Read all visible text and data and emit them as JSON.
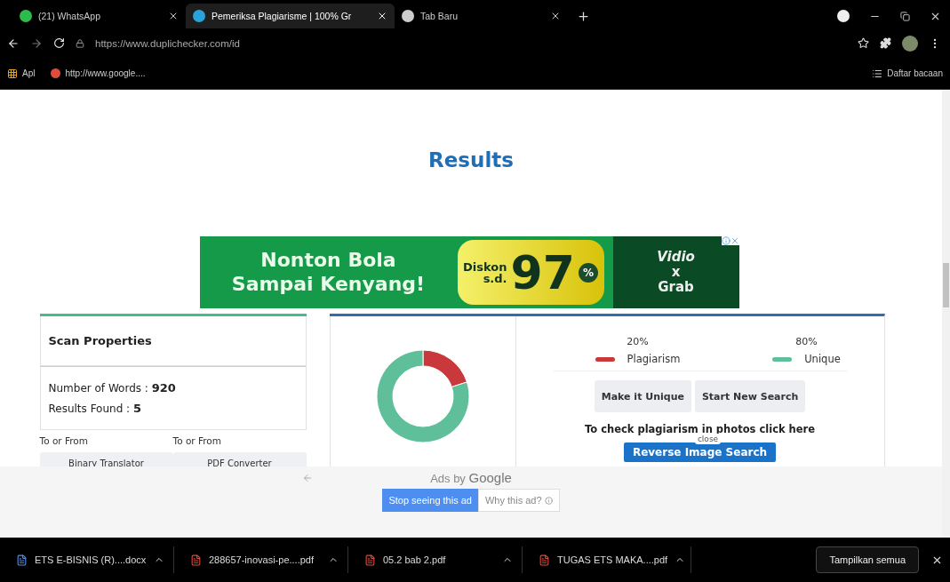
{
  "browser": {
    "tabs": [
      {
        "title": "(21) WhatsApp",
        "kind": "whatsapp",
        "selected": false
      },
      {
        "title": "Pemeriksa Plagiarisme | 100% Gr",
        "kind": "site",
        "selected": true
      },
      {
        "title": "Tab Baru",
        "kind": "chrome",
        "selected": false
      }
    ],
    "url": "https://www.duplichecker.com/id",
    "bookmarks": [
      {
        "label": "Apl",
        "kind": "apps"
      },
      {
        "label": "http://www.google....",
        "kind": "chrome"
      }
    ],
    "reading_list": "Daftar bacaan"
  },
  "page": {
    "heading": "Results",
    "ad_banner": {
      "line_1": "Nonton Bola",
      "line_2": "Sampai Kenyang!",
      "discount_1": "Diskon",
      "discount_2": "s.d.",
      "number": "97",
      "percent": "%",
      "brand_1": "Vidio",
      "brand_2": "x",
      "brand_3": "Grab"
    },
    "scan_properties": {
      "title": "Scan Properties",
      "rows": [
        {
          "label": "Number of Words : ",
          "value": "920"
        },
        {
          "label": "Results Found : ",
          "value": "5"
        }
      ],
      "links": [
        {
          "caption": "To or From",
          "button": "Binary Translator"
        },
        {
          "caption": "To or From",
          "button": "PDF Converter"
        }
      ]
    },
    "results": {
      "chart_data": {
        "type": "donut",
        "categories": [
          "Plagiarism",
          "Unique"
        ],
        "values": [
          20,
          80
        ]
      },
      "legend": [
        {
          "percent": "20%",
          "color": "#c9383a"
        },
        {
          "percent": "80%",
          "color": "#5fbf9a"
        }
      ],
      "buttons": [
        "Make it Unique",
        "Start New Search"
      ],
      "photo_hint": "To check plagiarism in photos click here",
      "reverse_button": "Reverse Image Search",
      "tooltip": "close"
    },
    "ad_overlay": {
      "label_prefix": "Ads by ",
      "label_brand": "Google",
      "stop_button": "Stop seeing this ad",
      "why_button": "Why this ad?"
    }
  },
  "downloads": {
    "items": [
      {
        "name": "ETS E-BISNIS (R)....docx",
        "kind": "docx"
      },
      {
        "name": "288657-inovasi-pe....pdf",
        "kind": "pdf"
      },
      {
        "name": "05.2 bab 2.pdf",
        "kind": "pdf"
      },
      {
        "name": "TUGAS ETS MAKA....pdf",
        "kind": "pdf"
      }
    ],
    "show_all": "Tampilkan semua"
  }
}
